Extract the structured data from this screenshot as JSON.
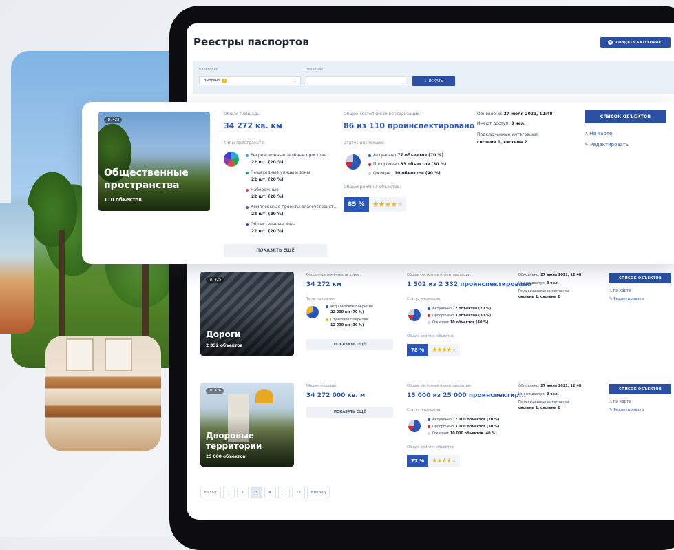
{
  "page": {
    "title": "Реестры паспортов",
    "create_button": "СОЗДАТЬ КАТЕГОРИЮ"
  },
  "filter": {
    "category_label": "Категория",
    "category_value": "Выбрано",
    "category_count": "3",
    "name_label": "Название",
    "name_value": "",
    "search_button": "ИСКАТЬ"
  },
  "card_public": {
    "id": "ID: 423",
    "name": "Общественные пространства",
    "count": "110 объектов",
    "area_label": "Общая площадь:",
    "area_value": "34 272 кв. км",
    "types_label": "Типы пространств:",
    "types": [
      {
        "name": "Рекреационные зелёные простран...",
        "value": "22 шт. (20 %)",
        "color": "#2ea7d8"
      },
      {
        "name": "Пешеходные улицы и зоны",
        "value": "22 шт. (20 %)",
        "color": "#24a35a"
      },
      {
        "name": "Набережные",
        "value": "22 шт. (20 %)",
        "color": "#e04a3a"
      },
      {
        "name": "Комплексные проекты благоустройст...",
        "value": "22 шт. (20 %)",
        "color": "#8c3fb5"
      },
      {
        "name": "Общественные зоны",
        "value": "22 шт. (20 %)",
        "color": "#3f3fd6"
      }
    ],
    "show_more": "ПОКАЗАТЬ ЕЩЁ",
    "inventory_label": "Общее состояние инвентаризации:",
    "inventory_value": "86 из 110 проинспектировано",
    "inspection_label": "Статус инспекции:",
    "inspection": [
      {
        "prefix": "Актуально",
        "value": "77 объектов (70 %)",
        "color": "#2a56b8"
      },
      {
        "prefix": "Просрочено",
        "value": "33 объектов (30 %)",
        "color": "#d6292f"
      },
      {
        "prefix": "Ожидает",
        "value": "10 объектов (40 %)",
        "color": "#c8d3e6"
      }
    ],
    "rating_label": "Общий рейтинг объектов:",
    "rating_value": "85 %",
    "rating_stars": 4,
    "updated_prefix": "Обновлено:",
    "updated_value": "27 июля 2021, 12:48",
    "access_prefix": "Имеют доступ:",
    "access_value": "3 чел.",
    "integrations_label": "Подключенные интеграции:",
    "integrations_value": "система 1, система 2",
    "list_button": "СПИСОК ОБЪЕКТОВ",
    "map_link": "На карте",
    "edit_link": "Редактировать"
  },
  "card_roads": {
    "id": "ID: 425",
    "name": "Дороги",
    "count": "2 332 объектов",
    "area_label": "Общая протяжённость дорог:",
    "area_value": "34 272 км",
    "types_label": "Типы покрытия:",
    "types": [
      {
        "name": "Асфальтовое покрытие",
        "value": "22 000 км (70 %)",
        "color": "#2a56b8"
      },
      {
        "name": "Грунтовое покрытие",
        "value": "12 000 км (30 %)",
        "color": "#f2b51b"
      }
    ],
    "show_more": "ПОКАЗАТЬ ЕЩЁ",
    "inventory_label": "Общее состояние инвентаризации:",
    "inventory_value": "1 502 из 2 332 проинспектировано",
    "inspection_label": "Статус инспекции:",
    "inspection": [
      {
        "prefix": "Актуально",
        "value": "12 объектов (70 %)",
        "color": "#2a56b8"
      },
      {
        "prefix": "Просрочено",
        "value": "3 объектов (30 %)",
        "color": "#d6292f"
      },
      {
        "prefix": "Ожидает",
        "value": "10 объектов (40 %)",
        "color": "#c8d3e6"
      }
    ],
    "rating_label": "Общий рейтинг объектов:",
    "rating_value": "78 %",
    "rating_stars": 4,
    "updated_prefix": "Обновлено:",
    "updated_value": "27 июля 2021, 12:48",
    "access_prefix": "Имеют доступ:",
    "access_value": "3 чел.",
    "integrations_label": "Подключенные интеграции:",
    "integrations_value": "система 1, система 2",
    "list_button": "СПИСОК ОБЪЕКТОВ",
    "map_link": "На карте",
    "edit_link": "Редактировать"
  },
  "card_yards": {
    "id": "ID: 426",
    "name": "Дворовые территории",
    "count": "25 000 объектов",
    "area_label": "Общая площадь:",
    "area_value": "34 272 000 кв. м",
    "show_more": "ПОКАЗАТЬ ЕЩЁ",
    "inventory_label": "Общее состояние инвентаризации:",
    "inventory_value": "15 000 из 25 000 проинспектир...",
    "inspection_label": "Статус инспекции:",
    "inspection": [
      {
        "prefix": "Актуально",
        "value": "12 000 объектов (70 %)",
        "color": "#2a56b8"
      },
      {
        "prefix": "Просрочено",
        "value": "3 000 объектов (30 %)",
        "color": "#d6292f"
      },
      {
        "prefix": "Ожидает",
        "value": "10 000 объектов (40 %)",
        "color": "#c8d3e6"
      }
    ],
    "rating_label": "Общий рейтинг объектов:",
    "rating_value": "77 %",
    "rating_stars": 4,
    "updated_prefix": "Обновлено:",
    "updated_value": "27 июля 2021, 12:48",
    "access_prefix": "Имеют доступ:",
    "access_value": "3 чел.",
    "integrations_label": "Подключенные интеграции:",
    "integrations_value": "система 1, система 2",
    "list_button": "СПИСОК ОБЪЕКТОВ",
    "map_link": "На карте",
    "edit_link": "Редактировать"
  },
  "pagination": {
    "prev": "Назад",
    "pages": [
      "1",
      "2",
      "3",
      "4",
      "...",
      "73"
    ],
    "active": "3",
    "next": "Вперёд"
  },
  "icons": {
    "plus": "plus-icon",
    "search": "search-icon",
    "chevron": "chevron-down-icon",
    "map": "map-icon",
    "edit": "pencil-icon"
  },
  "colors": {
    "accent": "#2a4fa3",
    "link": "#2a56b8",
    "star": "#f2b51b"
  }
}
